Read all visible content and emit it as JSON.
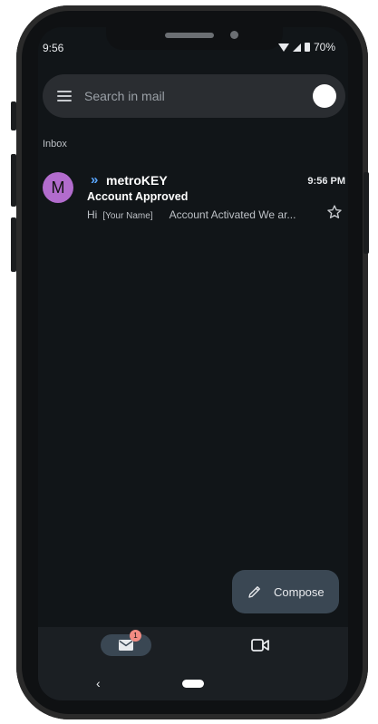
{
  "status_bar": {
    "time": "9:56",
    "battery": "70%"
  },
  "search": {
    "placeholder": "Search in mail"
  },
  "section": {
    "label": "Inbox"
  },
  "email": {
    "avatar_letter": "M",
    "importance_marker": "»",
    "sender": "metroKEY",
    "time": "9:56 PM",
    "subject": "Account Approved",
    "preview_greeting": "Hi",
    "preview_name": "[Your Name]",
    "preview_text": "Account Activated We ar...",
    "starred": false
  },
  "compose": {
    "label": "Compose"
  },
  "bottom_nav": {
    "mail_badge": "1"
  },
  "colors": {
    "background": "#111518",
    "accent": "#5aa7ff",
    "avatar": "#b26ccd",
    "badge": "#f28b82"
  },
  "icons": [
    "menu-icon",
    "star-icon",
    "pencil-icon",
    "mail-icon",
    "video-icon",
    "back-icon"
  ]
}
